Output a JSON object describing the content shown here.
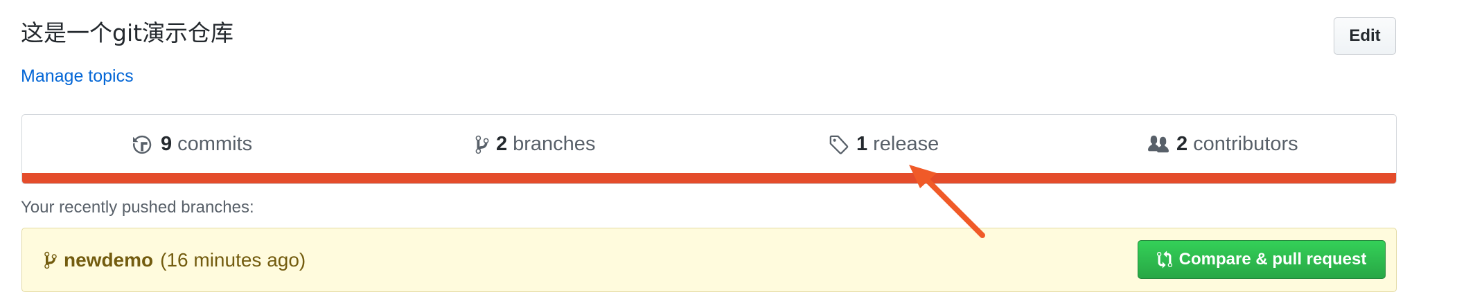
{
  "repo": {
    "description": "这是一个git演示仓库",
    "edit_label": "Edit",
    "manage_topics_label": "Manage topics"
  },
  "stats": {
    "commits": {
      "count": "9",
      "label": "commits",
      "icon": "history-icon"
    },
    "branches": {
      "count": "2",
      "label": "branches",
      "icon": "git-branch-icon"
    },
    "release": {
      "count": "1",
      "label": "release",
      "icon": "tag-icon"
    },
    "contributors": {
      "count": "2",
      "label": "contributors",
      "icon": "people-icon"
    },
    "language_bar": {
      "fraction": 1.0,
      "color": "#e44c2b"
    }
  },
  "recent": {
    "heading": "Your recently pushed branches:",
    "branch_name": "newdemo",
    "time_ago": "(16 minutes ago)",
    "compare_label": "Compare & pull request"
  },
  "colors": {
    "link": "#0366d6",
    "primary_button": "#28a745",
    "annotation_arrow": "#f05a28"
  }
}
